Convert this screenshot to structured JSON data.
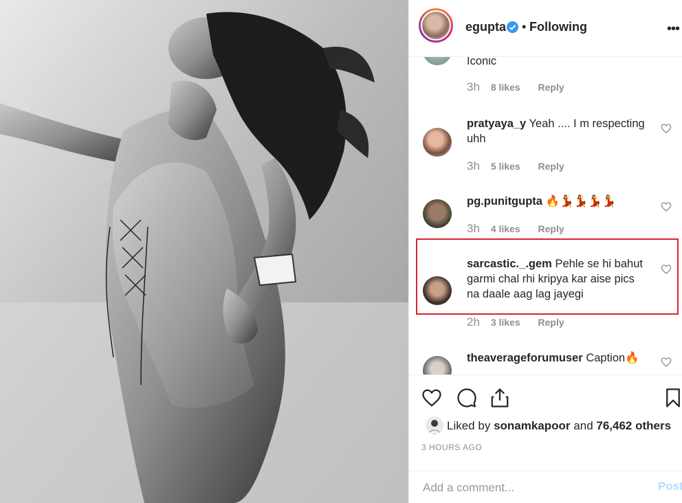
{
  "header": {
    "username": "egupta",
    "separator": "•",
    "follow_status": "Following",
    "more": "•••",
    "verified_color": "#3897f0"
  },
  "comments": [
    {
      "username": "",
      "text": "Iconic",
      "time": "3h",
      "likes": "8 likes",
      "reply": "Reply"
    },
    {
      "username": "pratyaya_y",
      "text": "Yeah .... I m respecting uhh",
      "time": "3h",
      "likes": "5 likes",
      "reply": "Reply"
    },
    {
      "username": "pg.punitgupta",
      "text": "🔥💃💃💃💃",
      "time": "3h",
      "likes": "4 likes",
      "reply": "Reply"
    },
    {
      "username": "sarcastic._.gem",
      "text": "Pehle se hi bahut garmi chal rhi kripya kar aise pics na daale aag lag jayegi",
      "time": "2h",
      "likes": "3 likes",
      "reply": "Reply"
    },
    {
      "username": "theaverageforumuser",
      "text": "Caption🔥",
      "time": "",
      "likes": "",
      "reply": ""
    }
  ],
  "actions": {
    "like_icon": "heart-icon",
    "comment_icon": "comment-icon",
    "share_icon": "share-icon",
    "save_icon": "bookmark-icon"
  },
  "likes": {
    "prefix": "Liked by",
    "user": "sonamkapoor",
    "middle": "and",
    "count": "76,462 others"
  },
  "timestamp": "3 HOURS AGO",
  "add_comment": {
    "placeholder": "Add a comment...",
    "post_label": "Post"
  },
  "colors": {
    "highlight_border": "#d9232e",
    "post_disabled": "#b3dbff",
    "meta_gray": "#8e8e8e"
  }
}
